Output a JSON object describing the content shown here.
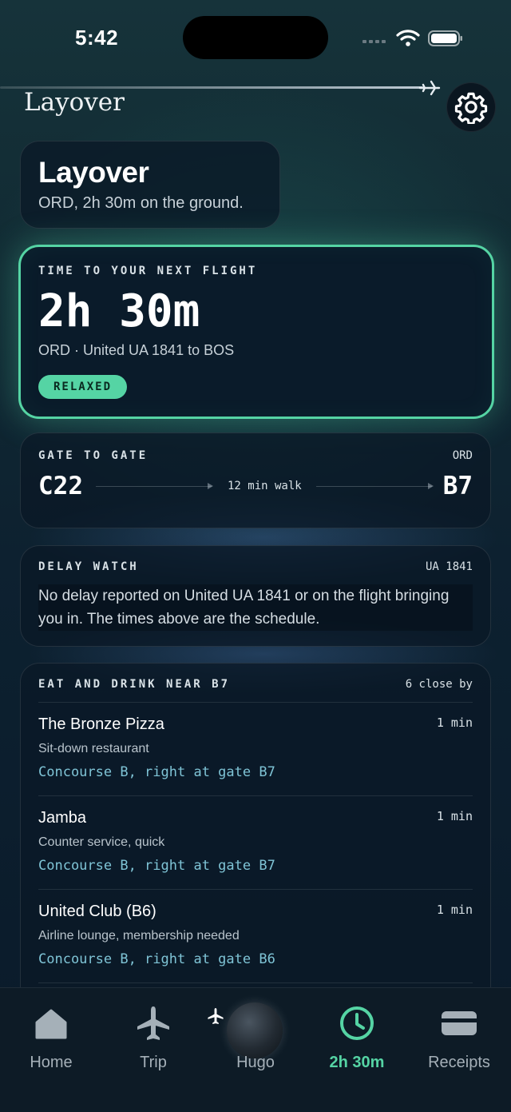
{
  "status": {
    "time": "5:42"
  },
  "app": {
    "title": "Layover"
  },
  "hero": {
    "title": "Layover",
    "subtitle": "ORD, 2h 30m on the ground."
  },
  "countdown": {
    "label": "TIME TO YOUR NEXT FLIGHT",
    "time": "2h 30m",
    "flight": "ORD · United UA 1841 to BOS",
    "badge": "RELAXED"
  },
  "gate": {
    "label": "GATE TO GATE",
    "airport": "ORD",
    "from": "C22",
    "walk": "12 min walk",
    "to": "B7"
  },
  "delay": {
    "label": "DELAY WATCH",
    "flight": "UA 1841",
    "message": "No delay reported on United UA 1841 or on the flight bringing you in. The times above are the schedule."
  },
  "food": {
    "label": "EAT AND DRINK NEAR B7",
    "count": "6 close by",
    "items": [
      {
        "name": "The Bronze Pizza",
        "minutes": "1 min",
        "type": "Sit-down restaurant",
        "location": "Concourse B, right at gate B7"
      },
      {
        "name": "Jamba",
        "minutes": "1 min",
        "type": "Counter service, quick",
        "location": "Concourse B, right at gate B7"
      },
      {
        "name": "United Club (B6)",
        "minutes": "1 min",
        "type": "Airline lounge, membership needed",
        "location": "Concourse B, right at gate B6"
      }
    ]
  },
  "tabs": [
    {
      "label": "Home",
      "icon": "home-icon"
    },
    {
      "label": "Trip",
      "icon": "plane-icon"
    },
    {
      "label": "Hugo",
      "icon": "globe-icon"
    },
    {
      "label": "2h 30m",
      "icon": "clock-icon"
    },
    {
      "label": "Receipts",
      "icon": "wallet-icon"
    }
  ],
  "colors": {
    "accent": "#55d4a4",
    "location": "#7fc4d6",
    "background": "#0d2130"
  }
}
